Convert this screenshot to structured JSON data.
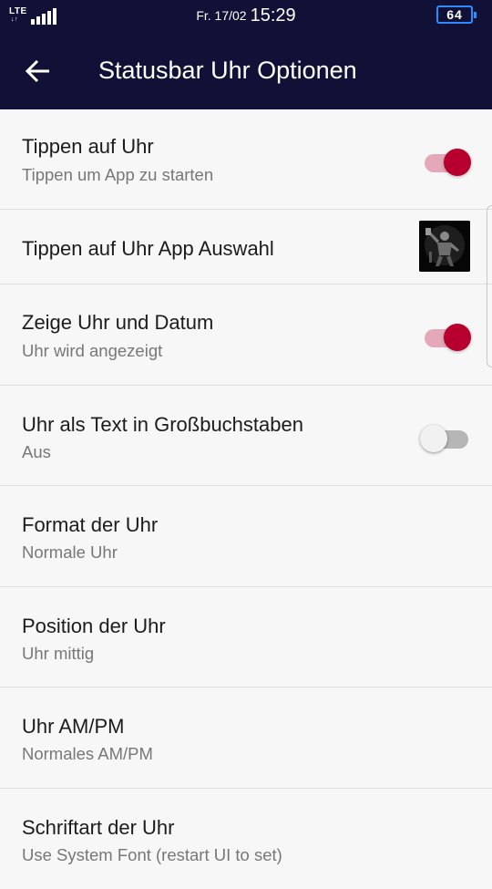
{
  "status": {
    "network": "LTE",
    "date": "Fr. 17/02",
    "time": "15:29",
    "battery": "64"
  },
  "header": {
    "title": "Statusbar Uhr Optionen",
    "back_icon": "arrow-left-icon"
  },
  "colors": {
    "header_bg": "#111138",
    "accent": "#b8002e",
    "accent_track": "#e4a9b8"
  },
  "settings": [
    {
      "title": "Tippen auf Uhr",
      "summary": "Tippen um App zu starten",
      "control": "toggle",
      "state": "on"
    },
    {
      "title": "Tippen auf Uhr App Auswahl",
      "control": "app-icon"
    },
    {
      "title": "Zeige Uhr und Datum",
      "summary": "Uhr wird angezeigt",
      "control": "toggle",
      "state": "on"
    },
    {
      "title": "Uhr als Text in Großbuchstaben",
      "summary": "Aus",
      "control": "toggle",
      "state": "off"
    },
    {
      "title": "Format der Uhr",
      "summary": "Normale Uhr"
    },
    {
      "title": "Position der Uhr",
      "summary": "Uhr mittig"
    },
    {
      "title": "Uhr AM/PM",
      "summary": "Normales AM/PM"
    },
    {
      "title": "Schriftart der Uhr",
      "summary": "Use System Font (restart UI to set)"
    }
  ]
}
